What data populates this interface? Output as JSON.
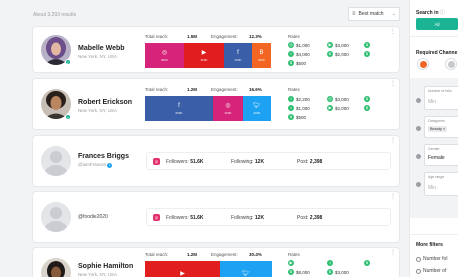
{
  "results": {
    "count_text": "About 3,293 results"
  },
  "sort": {
    "label": "Best match"
  },
  "influencers": [
    {
      "name": "Mabelle Webb",
      "location": "New York, NY, USA",
      "reach_label": "Total reach:",
      "reach": "1.5M",
      "engagement_label": "Engagement:",
      "engagement": "12.3%",
      "rates_label": "Rates",
      "blocks": [
        {
          "label": "350K",
          "color": "#d6247a"
        },
        {
          "label": "350K",
          "color": "#e01e1e"
        },
        {
          "label": "400K",
          "color": "#3b5ea8"
        },
        {
          "label": "400K",
          "color": "#f26522"
        }
      ],
      "rates": [
        "$1,000",
        "$3,000",
        "",
        "$4,000",
        "$2,000",
        "",
        "$500",
        "",
        ""
      ]
    },
    {
      "name": "Robert Erickson",
      "location": "New York, NY, USA",
      "reach_label": "Total reach:",
      "reach": "1.2M",
      "engagement_label": "Engagement:",
      "engagement": "16.6%",
      "rates_label": "Rates",
      "blocks": [
        {
          "label": "600K",
          "color": "#3b5ea8"
        },
        {
          "label": "300K",
          "color": "#d6247a"
        },
        {
          "label": "300K",
          "color": "#1da1f2"
        }
      ],
      "rates": [
        "$2,200",
        "$3,000",
        "",
        "$1,000",
        "$2,000",
        "",
        "$500",
        "",
        ""
      ]
    },
    {
      "name": "Frances Briggs",
      "handle": "@iamFrances",
      "followers_label": "Followers:",
      "followers": "51.6K",
      "following_label": "Following:",
      "following": "12K",
      "post_label": "Post:",
      "posts": "2,398"
    },
    {
      "handle": "@foodie2020",
      "followers_label": "Followers:",
      "followers": "51.6K",
      "following_label": "Following:",
      "following": "12K",
      "post_label": "Post:",
      "posts": "2,398"
    },
    {
      "name": "Sophie Hamilton",
      "location": "New York, NY, USA",
      "reach_label": "Total reach:",
      "reach": "1.2M",
      "engagement_label": "Engagement:",
      "engagement": "30.4%",
      "rates_label": "Rates",
      "rates": [
        "$8,000",
        "$3,000",
        ""
      ]
    }
  ],
  "filters": {
    "search_in": "Search in",
    "all_label": "All",
    "required_channels": "Required Channe",
    "number_followers_label": "Number of follo",
    "min_placeholder": "Min",
    "categories_label": "Categories",
    "category_chip": "Beauty",
    "gender_label": "Gender",
    "gender_value": "Female",
    "age_label": "Age range",
    "more_filters": "More filters",
    "option1": "Number fol",
    "option2": "Number of"
  },
  "colors": {
    "accent": "#1ab394",
    "rate_green": "#2fbf71",
    "instagram": "#d6247a",
    "youtube": "#e01e1e",
    "facebook": "#3b5ea8",
    "twitter": "#1da1f2",
    "blogger": "#f26522"
  },
  "icons": [
    "sort-icon",
    "chevron-down-icon",
    "kebab-menu-icon",
    "verified-icon",
    "instagram-icon",
    "youtube-icon",
    "facebook-icon",
    "twitter-icon",
    "blogger-icon",
    "dollar-icon",
    "info-icon"
  ]
}
